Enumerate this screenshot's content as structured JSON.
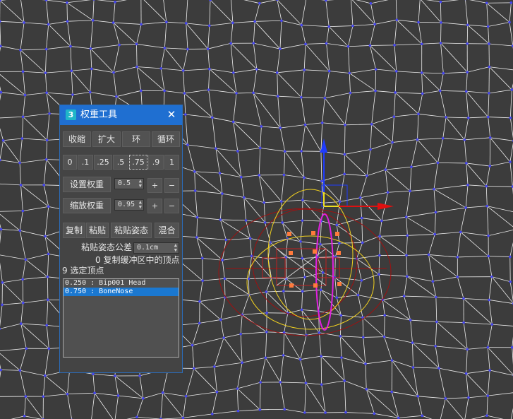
{
  "panel": {
    "title": "权重工具",
    "app_icon": "3",
    "close_glyph": "✕",
    "loop_buttons": [
      "收缩",
      "扩大",
      "环",
      "循环"
    ],
    "weight_presets": [
      "0",
      ".1",
      ".25",
      ".5",
      ".75",
      ".9",
      "1"
    ],
    "set_weight": {
      "label": "设置权重",
      "value": "0.5",
      "plus": "+",
      "minus": "−"
    },
    "scale_weight": {
      "label": "缩放权重",
      "value": "0.95",
      "plus": "+",
      "minus": "−"
    },
    "copy_buttons": [
      "复制",
      "粘贴",
      "粘贴姿态",
      "混合"
    ],
    "paste_tolerance": {
      "label": "粘贴姿态公差",
      "value": "0.1cm"
    },
    "buffer_text": "0  复制缓冲区中的顶点",
    "selected_text": "9  选定顶点",
    "bone_list": [
      {
        "weight": "0.250",
        "bone": "Bip001 Head",
        "selected": false
      },
      {
        "weight": "0.750",
        "bone": "BoneNose",
        "selected": true
      }
    ]
  },
  "colors": {
    "viewport_bg": "#3c3c3c",
    "wire": "#f2f2f2",
    "vertex": "#4444ee",
    "yellow_wire": "#f0d020",
    "envelope": "#a01010",
    "magenta": "#e020e0",
    "gizmo_y": "#1f3cff",
    "gizmo_x": "#e01010",
    "title_bar": "#1f6fd1",
    "selection": "#1b78d0"
  }
}
